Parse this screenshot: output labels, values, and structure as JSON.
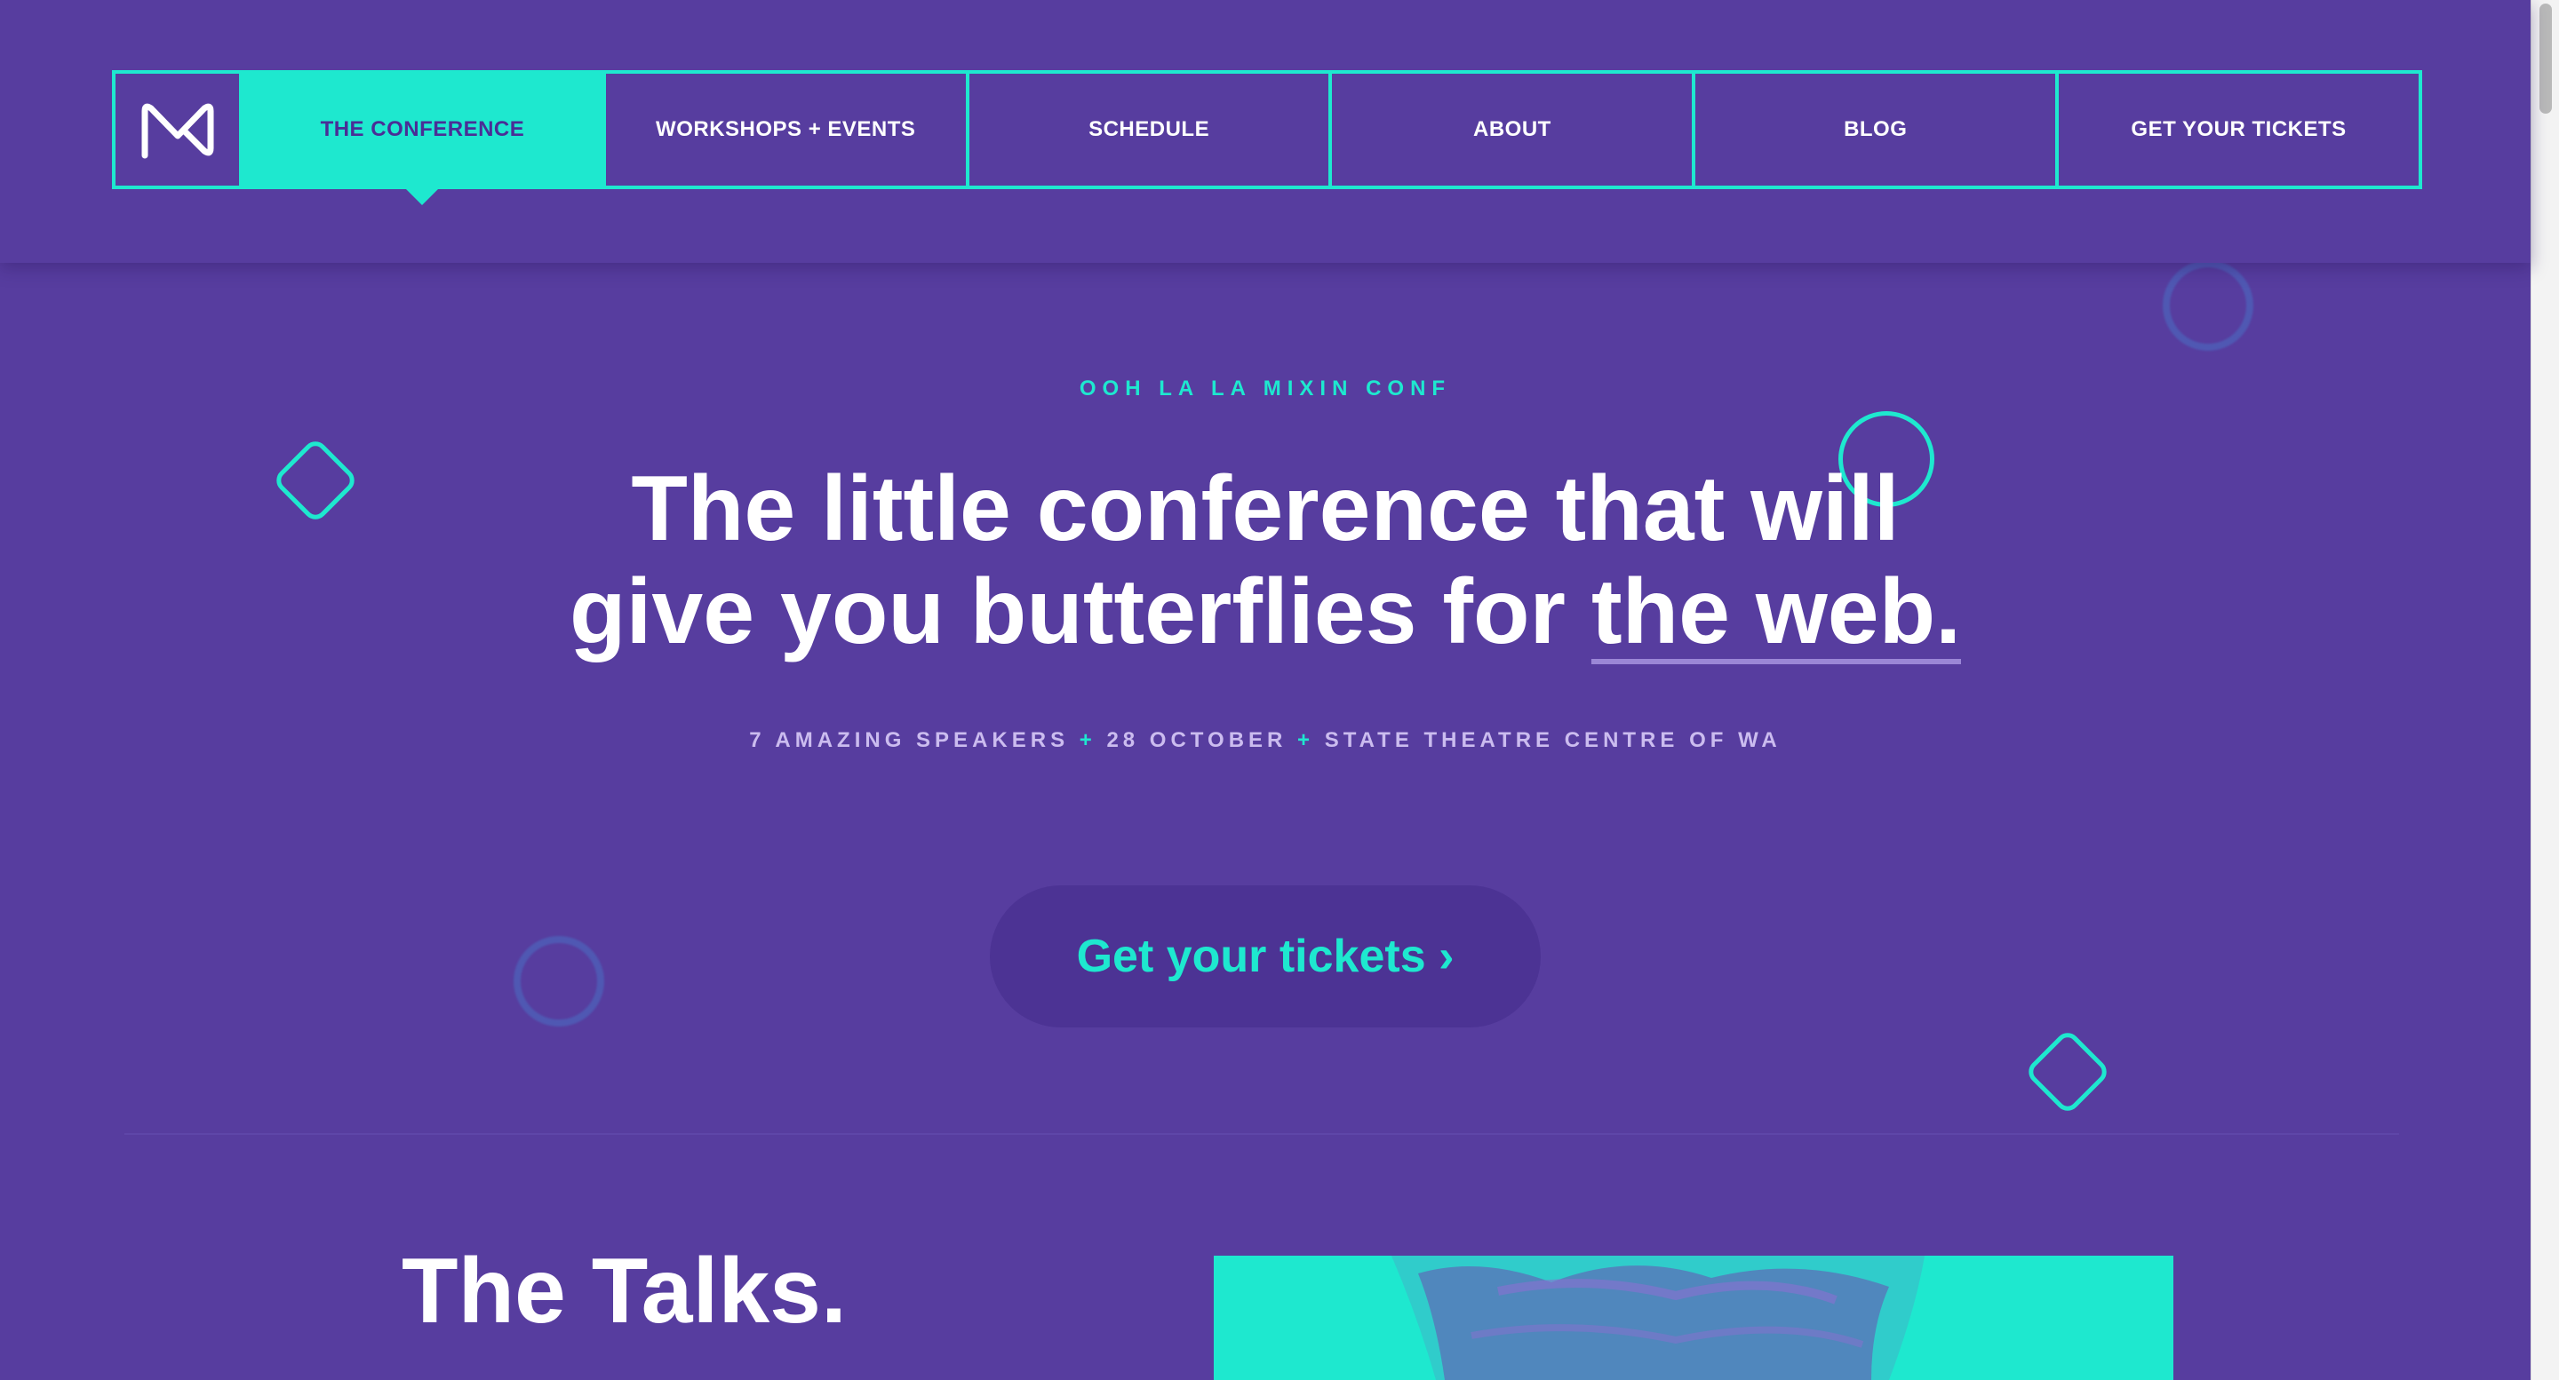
{
  "nav": {
    "logo_icon": "mixin-logo-icon",
    "items": [
      {
        "label": "THE CONFERENCE",
        "active": true
      },
      {
        "label": "WORKSHOPS + EVENTS",
        "active": false
      },
      {
        "label": "SCHEDULE",
        "active": false
      },
      {
        "label": "ABOUT",
        "active": false
      },
      {
        "label": "BLOG",
        "active": false
      },
      {
        "label": "GET YOUR TICKETS",
        "active": false
      }
    ]
  },
  "hero": {
    "eyebrow": "OOH LA LA MIXIN CONF",
    "headline_line1": "The little conference that will",
    "headline_line2_start": "give you butterflies for ",
    "headline_line2_underlined": "the web.",
    "meta_speakers": "7 AMAZING SPEAKERS",
    "meta_plus": "+",
    "meta_date": "28 OCTOBER",
    "meta_venue": "STATE THEATRE CENTRE OF WA",
    "cta_label": "Get your tickets ›"
  },
  "talks": {
    "title": "The Talks."
  },
  "colors": {
    "background": "#573d9f",
    "accent": "#1ee8cf",
    "text": "#ffffff",
    "meta_text": "#cbbcef"
  }
}
